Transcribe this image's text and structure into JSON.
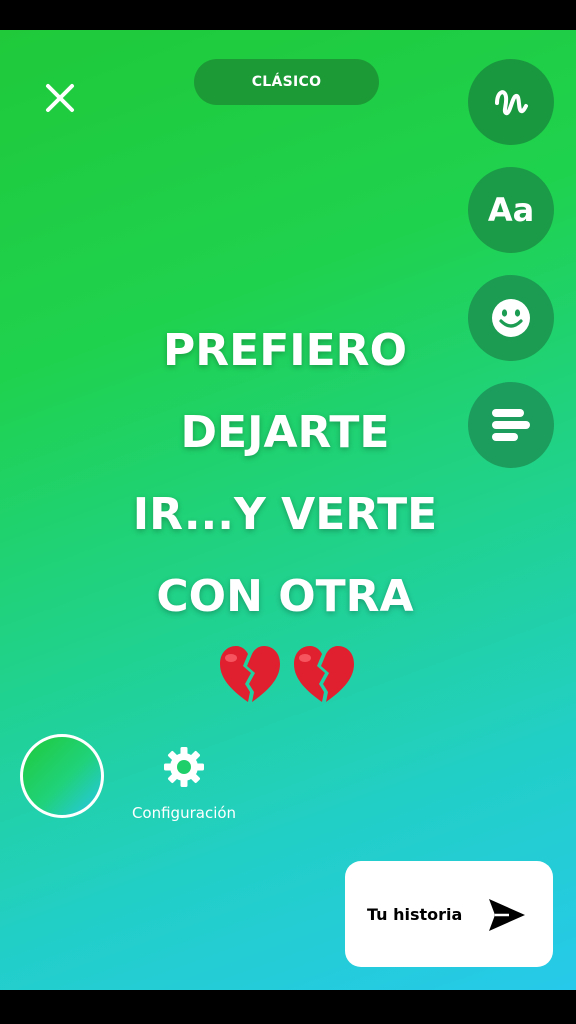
{
  "header": {
    "mode_label": "CLÁSICO"
  },
  "tools": [
    {
      "name": "draw",
      "icon": "squiggle-draw-icon"
    },
    {
      "name": "text",
      "label": "Aa",
      "icon": "text-aa-icon"
    },
    {
      "name": "sticker",
      "icon": "smiley-face-icon"
    },
    {
      "name": "align",
      "icon": "text-align-icon"
    }
  ],
  "story": {
    "lines": [
      "PREFIERO",
      "DEJARTE",
      "IR...Y VERTE",
      "CON OTRA"
    ],
    "emojis": [
      "broken-heart-emoji",
      "broken-heart-emoji"
    ]
  },
  "bottom": {
    "settings_label": "Configuración",
    "send_label": "Tu historia"
  },
  "colors": {
    "gradient_top": "#1fc93a",
    "gradient_bottom": "#26c9ea",
    "tool_button": "#1d9a3e",
    "pill": "#1c9a36",
    "broken_heart": "#e0202f"
  }
}
